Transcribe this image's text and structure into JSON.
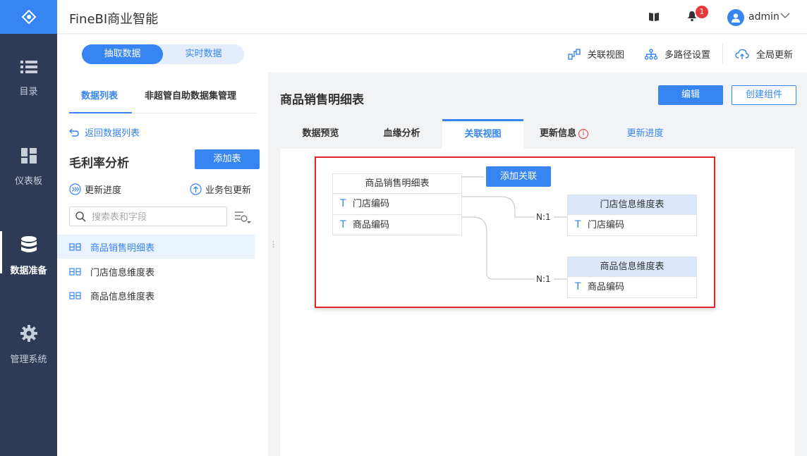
{
  "app": {
    "title": "FineBI商业智能",
    "username": "admin",
    "notification_count": "1"
  },
  "nav": [
    {
      "label": "目录",
      "icon": "list-icon"
    },
    {
      "label": "仪表板",
      "icon": "dashboard-icon"
    },
    {
      "label": "数据准备",
      "icon": "database-icon",
      "active": true
    },
    {
      "label": "管理系统",
      "icon": "gear-icon"
    }
  ],
  "mode": {
    "extract": "抽取数据",
    "realtime": "实时数据"
  },
  "toolbar": {
    "relation_view": "关联视图",
    "multipath": "多路径设置",
    "global_update": "全局更新"
  },
  "left": {
    "tab_list": "数据列表",
    "tab_nonadmin": "非超管自助数据集管理",
    "back": "返回数据列表",
    "package_title": "毛利率分析",
    "add_table": "添加表",
    "update_progress": "更新进度",
    "package_update": "业务包更新",
    "search_placeholder": "搜索表和字段",
    "tables": [
      "商品销售明细表",
      "门店信息维度表",
      "商品信息维度表"
    ]
  },
  "right": {
    "title": "商品销售明细表",
    "edit": "编辑",
    "create_component": "创建组件",
    "tabs": [
      "数据预览",
      "血缘分析",
      "关联视图",
      "更新信息",
      "更新进度"
    ]
  },
  "relation": {
    "main_table": {
      "name": "商品销售明细表",
      "fields": [
        "门店编码",
        "商品编码"
      ]
    },
    "add_relation": "添加关联",
    "field_type_glyph": "T",
    "links": [
      {
        "cardinality": "N:1",
        "table": "门店信息维度表",
        "field": "门店编码"
      },
      {
        "cardinality": "N:1",
        "table": "商品信息维度表",
        "field": "商品编码"
      }
    ]
  },
  "colors": {
    "brand": "#3685f2",
    "nav_bg": "#2e3b55",
    "highlight_border": "#e0242b"
  }
}
